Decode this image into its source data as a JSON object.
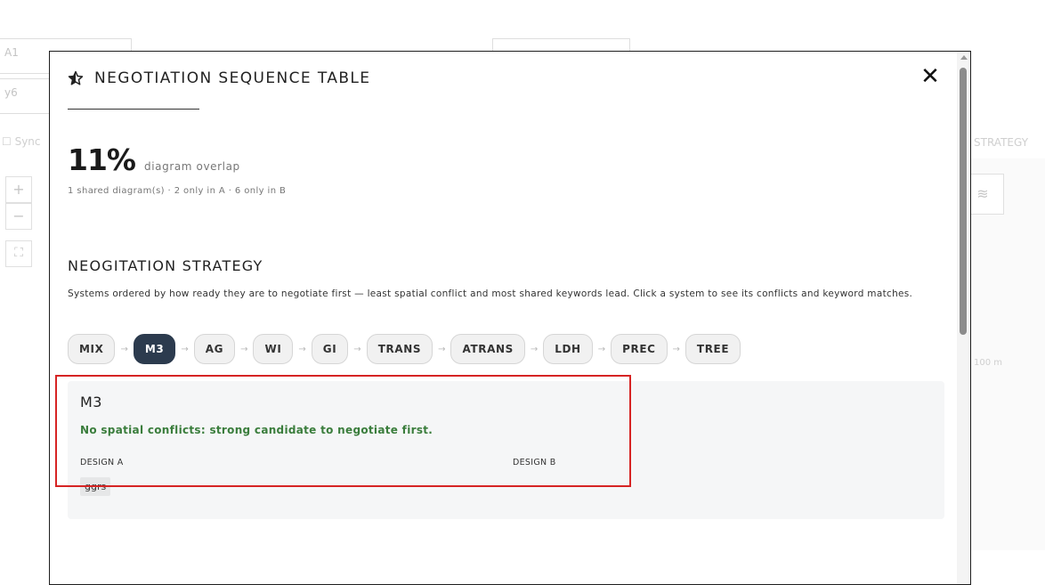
{
  "background": {
    "field_a": "A1",
    "field_b": "y6",
    "sync_label": "Sync",
    "strategy_label": "STRATEGY",
    "scale_label": "100 m",
    "zoom_in": "+",
    "zoom_out": "−"
  },
  "modal": {
    "title": "NEGOTIATION SEQUENCE TABLE",
    "close_label": "✕",
    "overlap": {
      "percent": "11%",
      "label": "diagram overlap",
      "summary": "1 shared diagram(s) · 2 only in A · 6 only in B"
    },
    "strategy": {
      "heading": "NEOGITATION STRATEGY",
      "description": "Systems ordered by how ready they are to negotiate first — least spatial conflict and most shared keywords lead. Click a system to see its conflicts and keyword matches.",
      "arrow": "→",
      "systems": [
        "MIX",
        "M3",
        "AG",
        "WI",
        "GI",
        "TRANS",
        "ATRANS",
        "LDH",
        "PREC",
        "TREE"
      ],
      "selected": "M3"
    },
    "detail": {
      "title": "M3",
      "status": "No spatial conflicts: strong candidate to negotiate first.",
      "design_a_label": "DESIGN A",
      "design_b_label": "DESIGN B",
      "design_a_tags": [
        "ggrs"
      ]
    }
  },
  "colors": {
    "accent_dark": "#2c3b4e",
    "status_green": "#3a7d3c",
    "highlight_red": "#d62424"
  }
}
